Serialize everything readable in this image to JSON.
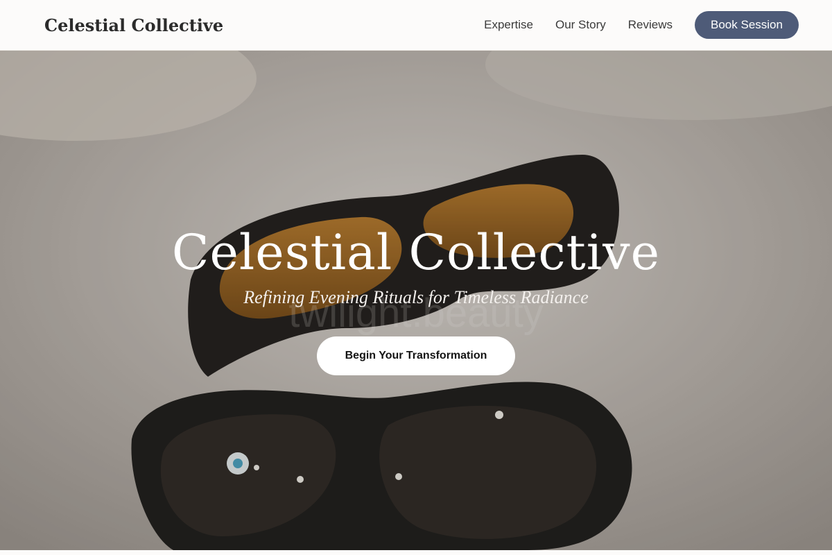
{
  "header": {
    "brand": "Celestial Collective",
    "nav": [
      {
        "label": "Expertise"
      },
      {
        "label": "Our Story"
      },
      {
        "label": "Reviews"
      }
    ],
    "cta_label": "Book Session",
    "cta_color": "#4e5b78"
  },
  "hero": {
    "title": "Celestial Collective",
    "subtitle": "Refining Evening Rituals for Timeless Radiance",
    "cta_label": "Begin Your Transformation",
    "image_watermark": "twilight.beauty",
    "image_subject": "two pairs of protective tinted goggles on a light surface"
  }
}
